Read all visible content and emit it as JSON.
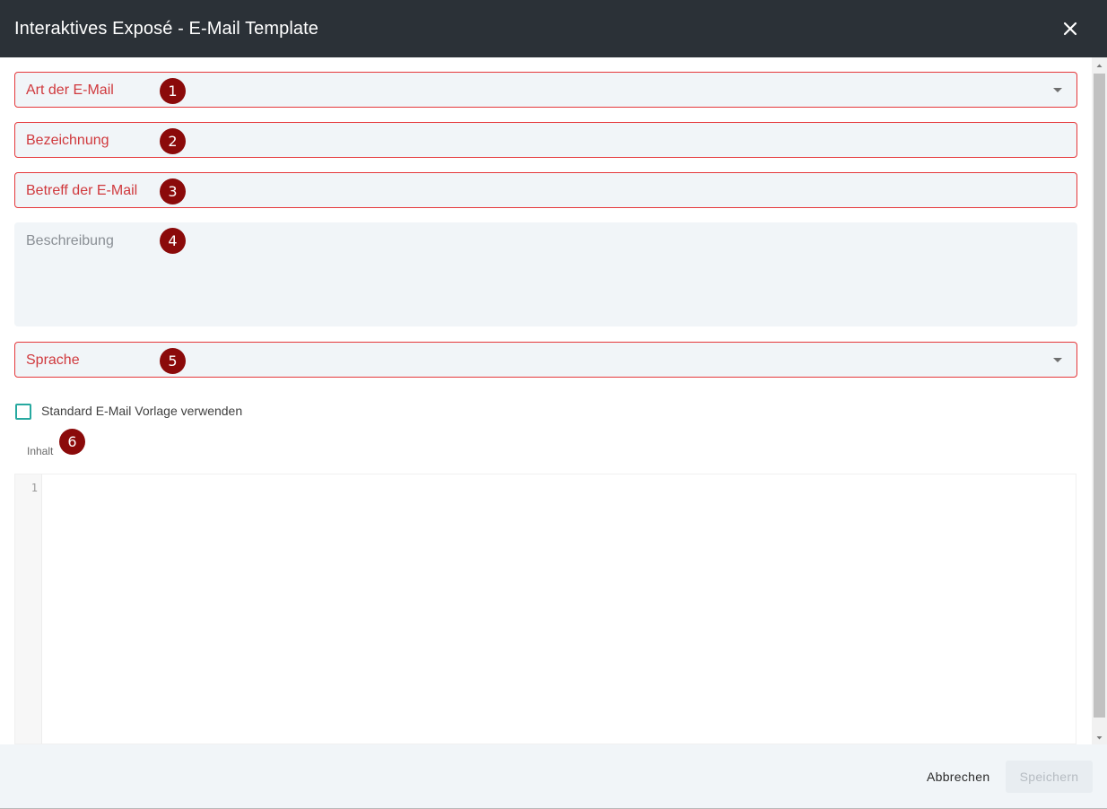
{
  "header": {
    "title": "Interaktives Exposé - E-Mail Template"
  },
  "form": {
    "email_type": {
      "label": "Art der E-Mail",
      "badge": "1"
    },
    "designation": {
      "label": "Bezeichnung",
      "badge": "2"
    },
    "subject": {
      "label": "Betreff der E-Mail",
      "badge": "3"
    },
    "description": {
      "label": "Beschreibung",
      "badge": "4"
    },
    "language": {
      "label": "Sprache",
      "badge": "5"
    },
    "default_template": {
      "label": "Standard E-Mail Vorlage verwenden",
      "checked": false
    },
    "content": {
      "label": "Inhalt",
      "badge": "6",
      "line_numbers": [
        "1"
      ]
    }
  },
  "footer": {
    "cancel_label": "Abbrechen",
    "save_label": "Speichern"
  },
  "colors": {
    "header_bg": "#2b3137",
    "error": "#e5383b",
    "badge": "#8b0a0a",
    "checkbox": "#27a9a0"
  }
}
